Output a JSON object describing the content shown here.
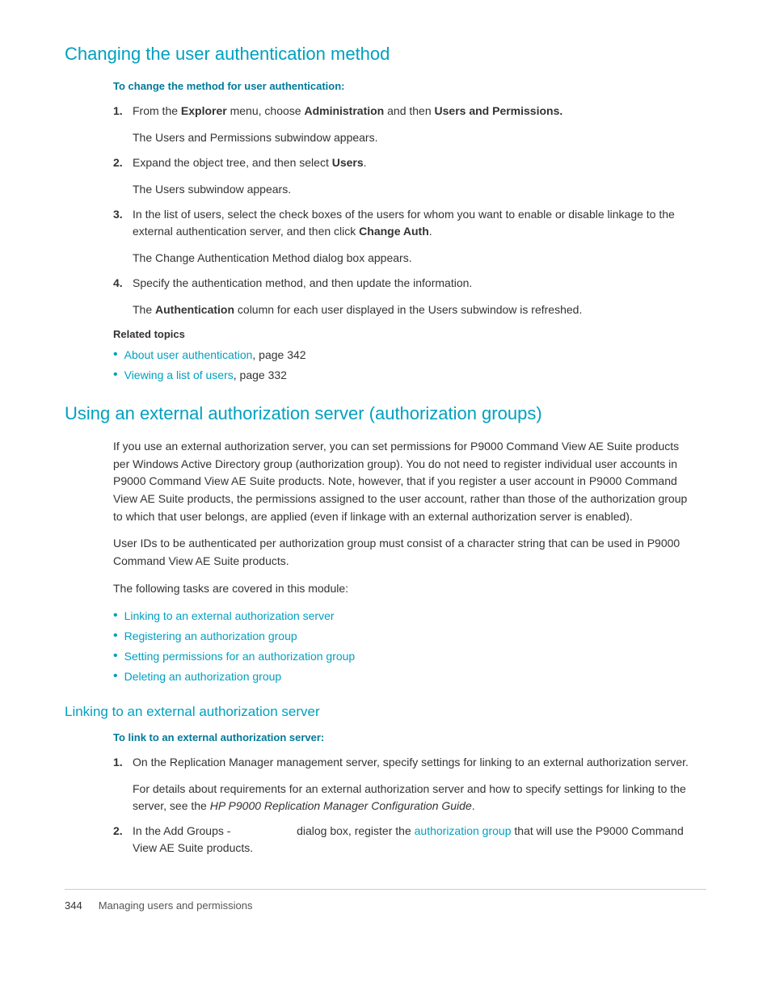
{
  "page": {
    "section1": {
      "title": "Changing the user authentication method",
      "procedure_heading": "To change the method for user authentication:",
      "steps": [
        {
          "num": "1.",
          "text_parts": [
            {
              "type": "text",
              "content": "From the "
            },
            {
              "type": "bold",
              "content": "Explorer"
            },
            {
              "type": "text",
              "content": " menu, choose "
            },
            {
              "type": "bold",
              "content": "Administration"
            },
            {
              "type": "text",
              "content": " and then "
            },
            {
              "type": "bold",
              "content": "Users and Permissions."
            }
          ],
          "note": "The Users and Permissions subwindow appears."
        },
        {
          "num": "2.",
          "text_parts": [
            {
              "type": "text",
              "content": "Expand the object tree, and then select "
            },
            {
              "type": "bold",
              "content": "Users"
            },
            {
              "type": "text",
              "content": "."
            }
          ],
          "note": "The Users subwindow appears."
        },
        {
          "num": "3.",
          "text_parts": [
            {
              "type": "text",
              "content": "In the list of users, select the check boxes of the users for whom you want to enable or disable linkage to the external authentication server, and then click "
            },
            {
              "type": "bold",
              "content": "Change Auth"
            },
            {
              "type": "text",
              "content": "."
            }
          ],
          "note": "The Change Authentication Method dialog box appears."
        },
        {
          "num": "4.",
          "text_parts": [
            {
              "type": "text",
              "content": "Specify the authentication method, and then update the information."
            }
          ],
          "note": "The Authentication column for each user displayed in the Users subwindow is refreshed."
        }
      ],
      "note_bold": "Authentication",
      "related_topics_label": "Related topics",
      "related_links": [
        {
          "text": "About user authentication",
          "suffix": ", page 342"
        },
        {
          "text": "Viewing a list of users",
          "suffix": ", page 332"
        }
      ]
    },
    "section2": {
      "title": "Using an external authorization server (authorization groups)",
      "body1": "If you use an external authorization server, you can set permissions for P9000 Command View AE Suite products per Windows Active Directory group (authorization group). You do not need to register individual user accounts in P9000 Command View AE Suite products. Note, however, that if you register a user account in P9000 Command View AE Suite products, the permissions assigned to the user account, rather than those of the authorization group to which that user belongs, are applied (even if linkage with an external authorization server is enabled).",
      "body2": "User IDs to be authenticated per authorization group must consist of a character string that can be used in P9000 Command View AE Suite products.",
      "body3": "The following tasks are covered in this module:",
      "task_links": [
        {
          "text": "Linking to an external authorization server"
        },
        {
          "text": "Registering an authorization group"
        },
        {
          "text": "Setting permissions for an authorization group"
        },
        {
          "text": "Deleting an authorization group"
        }
      ],
      "subsection": {
        "title": "Linking to an external authorization server",
        "procedure_heading": "To link to an external authorization server:",
        "steps": [
          {
            "num": "1.",
            "text": "On the Replication Manager management server, specify settings for linking to an external authorization server.",
            "note": "For details about requirements for an external authorization server and how to specify settings for linking to the server, see the HP P9000 Replication Manager Configuration Guide.",
            "note_italic": "HP P9000 Replication Manager Configuration Guide"
          },
          {
            "num": "2.",
            "text_parts": [
              {
                "type": "text",
                "content": "In the Add Groups - "
              },
              {
                "type": "underline",
                "content": "                "
              },
              {
                "type": "text",
                "content": " dialog box, register the authorization group that will use the P9000 Command View AE Suite products."
              }
            ]
          }
        ]
      }
    },
    "footer": {
      "page_num": "344",
      "text": "Managing users and permissions"
    }
  }
}
